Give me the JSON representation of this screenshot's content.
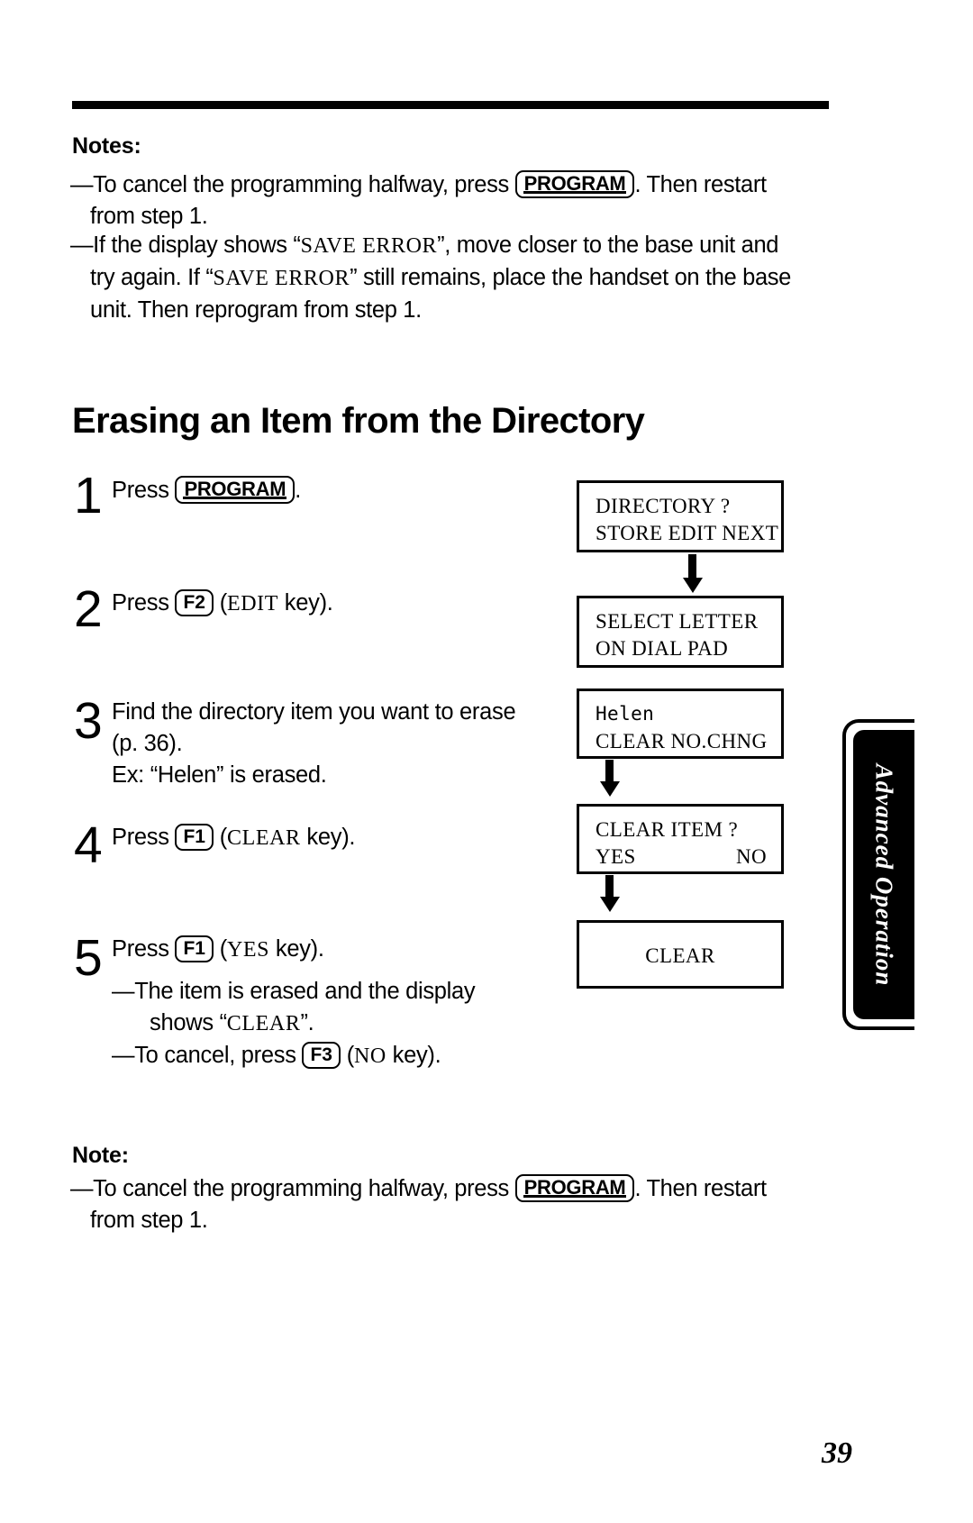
{
  "document": {
    "page_number": "39",
    "side_tab_label": "Advanced Operation"
  },
  "top_notes": {
    "heading": "Notes:",
    "items": [
      {
        "dash": "—",
        "part1": "To cancel the programming halfway, press ",
        "key": "PROGRAM",
        "part2": ". Then restart",
        "line2": "from step 1."
      },
      {
        "dash": "—",
        "line1_a": "If the display shows “",
        "line1_code": "SAVE ERROR",
        "line1_b": "”, move closer to the base unit and",
        "line2_a": "try again. If “",
        "line2_code": "SAVE ERROR",
        "line2_b": "” still remains, place the handset on the base",
        "line3": "unit. Then reprogram from step 1."
      }
    ]
  },
  "section": {
    "title": "Erasing an Item from the Directory"
  },
  "steps": [
    {
      "num": "1",
      "pre": "Press ",
      "key": "PROGRAM",
      "post": "."
    },
    {
      "num": "2",
      "pre": "Press ",
      "key": "F2",
      "mid": " (",
      "code": "EDIT",
      "post": " key)."
    },
    {
      "num": "3",
      "line1": "Find the directory item you want to erase",
      "line2": "(p. 36).",
      "line3": "Ex: “Helen” is erased."
    },
    {
      "num": "4",
      "pre": "Press ",
      "key": "F1",
      "mid": " (",
      "code": "CLEAR",
      "post": " key)."
    },
    {
      "num": "5",
      "pre": "Press ",
      "key": "F1",
      "mid": " (",
      "code": "YES",
      "post": " key).",
      "sub1_dash": "—",
      "sub1_line1": "The item is erased and the display",
      "sub1_line2_a": "shows “",
      "sub1_line2_code": "CLEAR",
      "sub1_line2_b": "”.",
      "sub2_dash": "—",
      "sub2_pre": "To cancel, press ",
      "sub2_key": "F3",
      "sub2_mid": " (",
      "sub2_code": "NO",
      "sub2_post": " key)."
    }
  ],
  "displays": [
    {
      "id": "display-directory",
      "line1": "DIRECTORY ?",
      "line2": "STORE EDIT NEXT"
    },
    {
      "id": "display-select-letter",
      "line1": "SELECT LETTER",
      "line2": "ON DIAL PAD"
    },
    {
      "id": "display-helen",
      "line1": "Helen",
      "line2_left": "CLEAR NO.",
      "line2_right": "CHNG"
    },
    {
      "id": "display-clear-item",
      "line1": "CLEAR ITEM ?",
      "line2_left": "YES",
      "line2_right": "NO"
    },
    {
      "id": "display-clear",
      "line1": "CLEAR"
    }
  ],
  "bottom_note": {
    "heading": "Note:",
    "dash": "—",
    "part1": "To cancel the programming halfway, press ",
    "key": "PROGRAM",
    "part2": ". Then restart",
    "line2": "from step 1."
  }
}
